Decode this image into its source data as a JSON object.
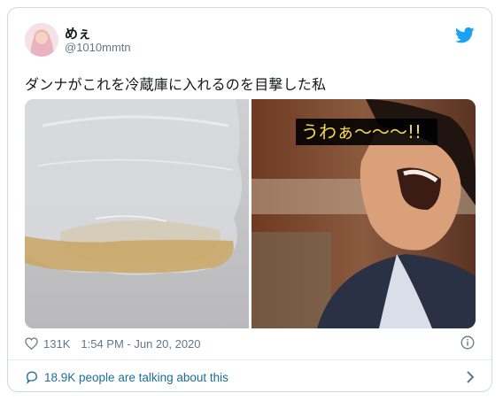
{
  "user": {
    "display_name": "めぇ",
    "handle": "@1010mmtn",
    "avatar_icon": "avatar-image"
  },
  "tweet": {
    "text": "ダンナがこれを冷蔵庫に入れるのを目撃した私",
    "image_caption": "うわぁ～～～!!",
    "likes": "131K",
    "timestamp": "1:54 PM - Jun 20, 2020"
  },
  "footer": {
    "talking": "18.9K people are talking about this"
  },
  "icons": {
    "brand": "twitter-bird-icon",
    "like": "heart-icon",
    "info": "info-icon",
    "talk": "speech-bubble-icon",
    "chevron": "chevron-right-icon"
  },
  "colors": {
    "brand_blue": "#1da1f2",
    "link_blue": "#1b6f9b",
    "muted": "#657786"
  }
}
